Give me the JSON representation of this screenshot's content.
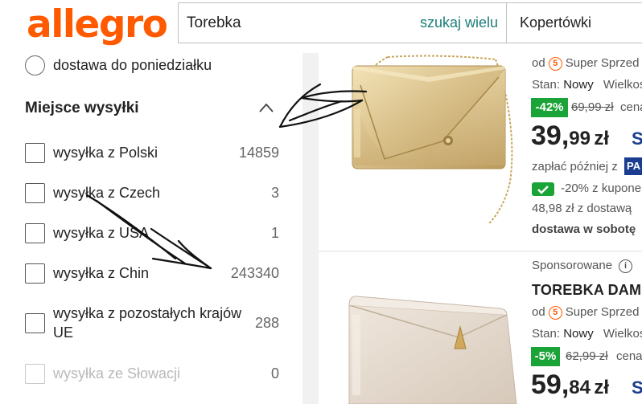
{
  "header": {
    "logo": "allegro",
    "search_value": "Torebka",
    "search_many": "szukaj wielu",
    "category": "Kopertówki"
  },
  "sidebar": {
    "delivery_option": "dostawa do poniedziałku",
    "section_title": "Miejsce wysyłki",
    "filters": [
      {
        "label": "wysyłka z Polski",
        "count": "14859"
      },
      {
        "label": "wysyłka z Czech",
        "count": "3"
      },
      {
        "label": "wysyłka z USA",
        "count": "1"
      },
      {
        "label": "wysyłka z Chin",
        "count": "243340"
      },
      {
        "label": "wysyłka z pozostałych krajów UE",
        "count": "288"
      },
      {
        "label": "wysyłka ze Słowacji",
        "count": "0"
      }
    ]
  },
  "products": [
    {
      "seller_prefix": "od",
      "seller_badge": "5",
      "seller": "Super Sprzed",
      "condition_label": "Stan:",
      "condition": "Nowy",
      "size_label": "Wielkoś",
      "discount": "-42%",
      "old_price": "69,99 zł",
      "old_price_suffix": "cena",
      "price_int": "39,",
      "price_dec": "99",
      "currency": "zł",
      "smart_mark": "S",
      "pay_later": "zapłać później z",
      "pay_later_badge": "PA",
      "coupon_text": "-20% z kupone",
      "with_delivery": "48,98 zł z dostawą",
      "delivery_day": "dostawa w sobotę"
    },
    {
      "sponsored": "Sponsorowane",
      "info_icon": "i",
      "title": "TOREBKA DAMSK",
      "seller_prefix": "od",
      "seller_badge": "5",
      "seller": "Super Sprzed",
      "condition_label": "Stan:",
      "condition": "Nowy",
      "size_label": "Wielkoś",
      "discount": "-5%",
      "old_price": "62,99 zł",
      "old_price_suffix": "cena",
      "price_int": "59,",
      "price_dec": "84",
      "currency": "zł",
      "smart_mark": "S"
    }
  ],
  "colors": {
    "brand": "#ff5a00",
    "teal_link": "#1b7f7a",
    "discount_green": "#1aa337",
    "smart_blue": "#1a3d8f"
  }
}
